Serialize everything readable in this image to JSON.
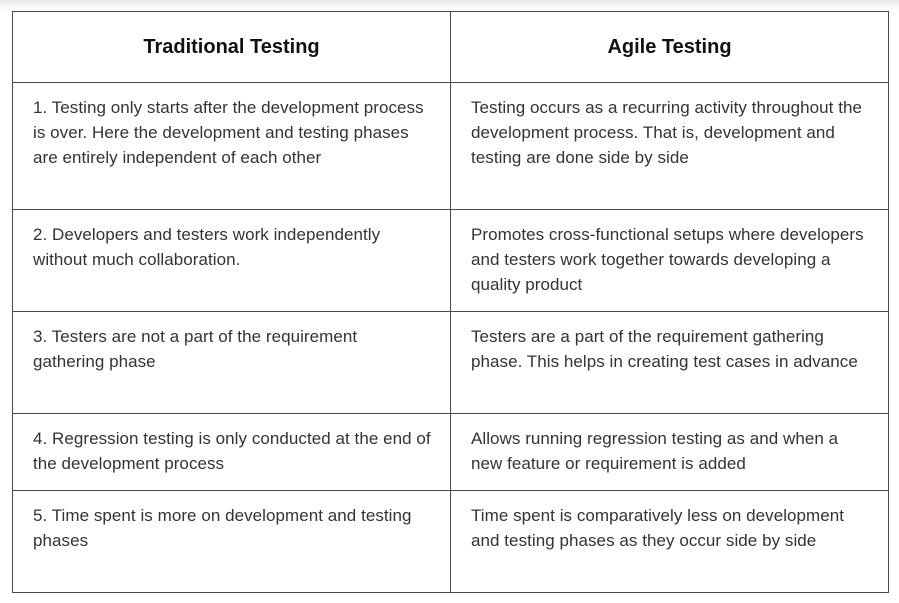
{
  "table": {
    "headers": [
      "Traditional Testing",
      "Agile Testing"
    ],
    "rows": [
      {
        "traditional": "1. Testing only starts after the development process is over. Here the development and testing phases are entirely independent of each other",
        "agile": "Testing occurs as a recurring activity throughout the development process. That is, development and testing are done side by side"
      },
      {
        "traditional": "2. Developers and testers work independently without much collaboration.",
        "agile": "Promotes cross-functional setups where developers and testers work together towards developing a quality product"
      },
      {
        "traditional": "3. Testers are not a part of the requirement gathering phase",
        "agile": "Testers are a part of the requirement gathering phase. This helps in creating test cases in advance"
      },
      {
        "traditional": "4. Regression testing is only conducted at the end of the development process",
        "agile": "Allows running regression testing as and when a new feature or requirement is added"
      },
      {
        "traditional": "5. Time spent is more on development and testing phases",
        "agile": "Time spent is comparatively less on development and testing phases as they occur side by side"
      }
    ]
  }
}
